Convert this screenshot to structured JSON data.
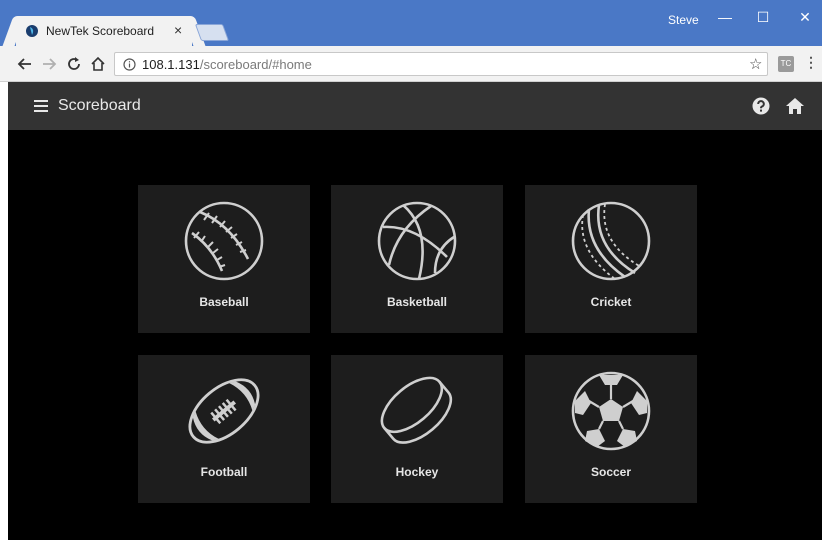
{
  "browser": {
    "tab_title": "NewTek Scoreboard",
    "tab_close": "×",
    "profile_name": "Steve",
    "window_controls": {
      "minimize": "—",
      "maximize": "☐",
      "close": "✕"
    },
    "url_host": "108.1.131",
    "url_path": "/scoreboard/#home",
    "extension_label": "TC",
    "icons": [
      "back-icon",
      "forward-icon",
      "reload-icon",
      "home-icon",
      "info-icon",
      "star-icon",
      "menu-icon"
    ]
  },
  "app": {
    "title": "Scoreboard",
    "header_icons": [
      "hamburger-menu-icon",
      "help-icon",
      "home-icon"
    ],
    "colors": {
      "header": "#333333",
      "body": "#000000",
      "tile": "#1d1d1d",
      "icon": "#cfcfcf"
    }
  },
  "sports": [
    {
      "label": "Baseball",
      "icon": "baseball-icon"
    },
    {
      "label": "Basketball",
      "icon": "basketball-icon"
    },
    {
      "label": "Cricket",
      "icon": "cricket-ball-icon"
    },
    {
      "label": "Football",
      "icon": "football-icon"
    },
    {
      "label": "Hockey",
      "icon": "hockey-puck-icon"
    },
    {
      "label": "Soccer",
      "icon": "soccer-ball-icon"
    }
  ]
}
